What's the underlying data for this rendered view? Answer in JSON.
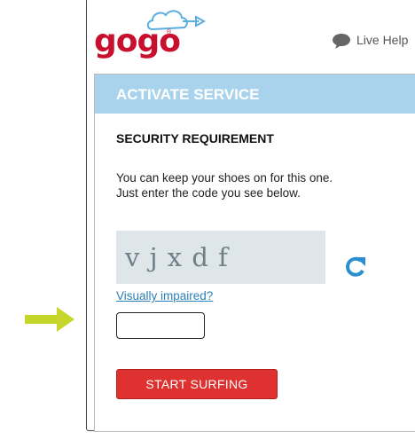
{
  "brand": {
    "logo_text": "gogo",
    "logo_reg": "®",
    "color": "#c8102e"
  },
  "header": {
    "live_help_label": "Live Help"
  },
  "panel": {
    "header_title": "ACTIVATE SERVICE",
    "header_color": "#a9d3ec",
    "section_title": "SECURITY REQUIREMENT",
    "instructions": [
      "You can keep your shoes on for this one.",
      "Just enter the code you see below."
    ],
    "captcha_text": "v j x d f",
    "visually_impaired_link": "Visually impaired?",
    "code_input": {
      "value": "",
      "placeholder": ""
    },
    "submit_label": "START SURFING",
    "submit_color": "#df3130"
  },
  "annotation": {
    "arrow_color": "#c5d52a",
    "arrow_icon": "arrow-right-icon"
  }
}
